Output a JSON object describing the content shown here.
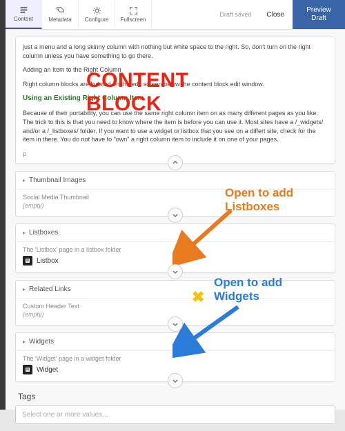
{
  "toolbar": {
    "tabs": [
      {
        "label": "Content"
      },
      {
        "label": "Metadata"
      },
      {
        "label": "Configure"
      },
      {
        "label": "Fullscreen"
      }
    ],
    "draft_saved": "Draft saved",
    "close": "Close",
    "preview": "Preview Draft"
  },
  "content_block": {
    "p1": "just a menu and a long skinny column with nothing but white space to the right. So, don't turn on the right column unless you have something to go there.",
    "p2": "Adding an Item to the Right Column",
    "p3": "Right column blocks are located on the edit screen below the content block edit window.",
    "h": "Using an Existing Right Column Item",
    "p4": "Because of their portability, you can use the same right column item on as many different pages as you like. The trick to this is that you need to know where the item is before you can use it. Most sites have a /_widgets/ and/or a /_listboxes/ folder. If you want to use a widget or listbox that you see on a differt site, check for the item in there. You do not have to \"own\" a right column item to include it on one of your pages.",
    "p_tag": "p"
  },
  "sections": {
    "thumbnail": {
      "title": "Thumbnail Images",
      "sub": "Social Media Thumbnail",
      "empty": "(empty)"
    },
    "listboxes": {
      "title": "Listboxes",
      "sub": "The 'Listbox' page in a listbox folder",
      "item": "Listbox"
    },
    "related": {
      "title": "Related Links",
      "sub": "Custom Header Text",
      "empty": "(empty)"
    },
    "widgets": {
      "title": "Widgets",
      "sub": "The 'Widget' page in a widget folder",
      "item": "Widget"
    }
  },
  "tags": {
    "label": "Tags",
    "placeholder": "Select one or more values..."
  },
  "overlay": {
    "title": "CONTENT BLOCK",
    "ann1a": "Open to add",
    "ann1b": "Listboxes",
    "ann2a": "Open to add",
    "ann2b": "Widgets"
  }
}
